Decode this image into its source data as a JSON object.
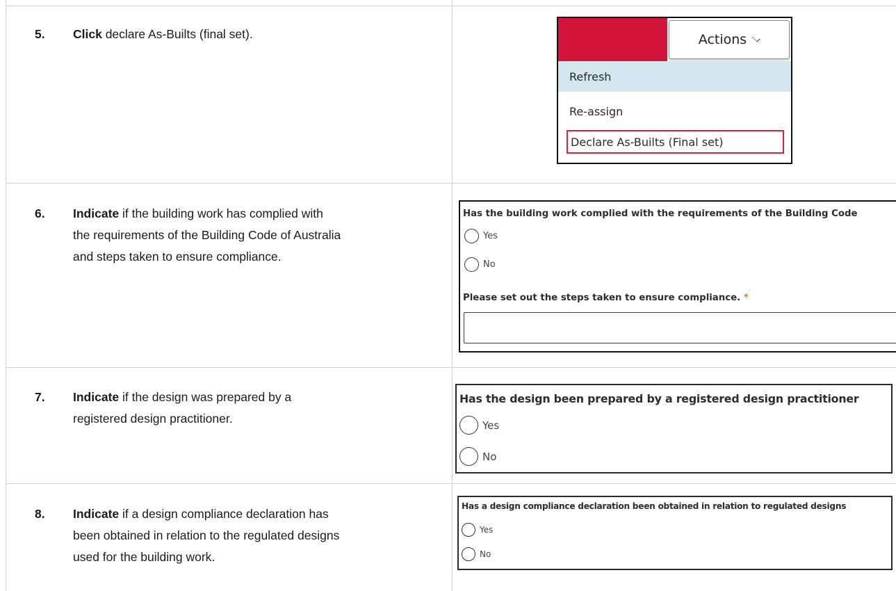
{
  "steps": [
    {
      "num": "5.",
      "verb": "Click",
      "lines": [
        " declare As-Builts (final set)."
      ]
    },
    {
      "num": "6.",
      "verb": "Indicate",
      "lines": [
        " if the building work has complied with",
        "the requirements of the Building Code of Australia",
        "and steps taken to ensure compliance."
      ]
    },
    {
      "num": "7.",
      "verb": "Indicate",
      "lines": [
        " if the design was prepared by a",
        "registered design practitioner."
      ]
    },
    {
      "num": "8.",
      "verb": "Indicate",
      "lines": [
        " if a design compliance declaration has",
        "been obtained in relation to the regulated designs",
        "used for the building work."
      ]
    }
  ],
  "actions_menu": {
    "button_label": "Actions",
    "items": [
      "Refresh",
      "Re-assign",
      "Declare As-Builts (Final set)"
    ],
    "highlighted": "Refresh",
    "outlined": "Declare As-Builts (Final set)",
    "colors": {
      "red_block": "#d2153a",
      "hover": "#d4e6ee",
      "outline": "#e0222c"
    }
  },
  "form_bca": {
    "question": "Has the building work complied with the requirements of the Building Code",
    "options": [
      "Yes",
      "No"
    ],
    "steps_label": "Please set out the steps taken to ensure compliance.",
    "required_mark": "*"
  },
  "form_design": {
    "question": "Has the design been prepared by a registered design practitioner",
    "options": [
      "Yes",
      "No"
    ]
  },
  "form_declaration": {
    "question": "Has a design compliance declaration been obtained in relation to regulated designs",
    "options": [
      "Yes",
      "No"
    ]
  }
}
